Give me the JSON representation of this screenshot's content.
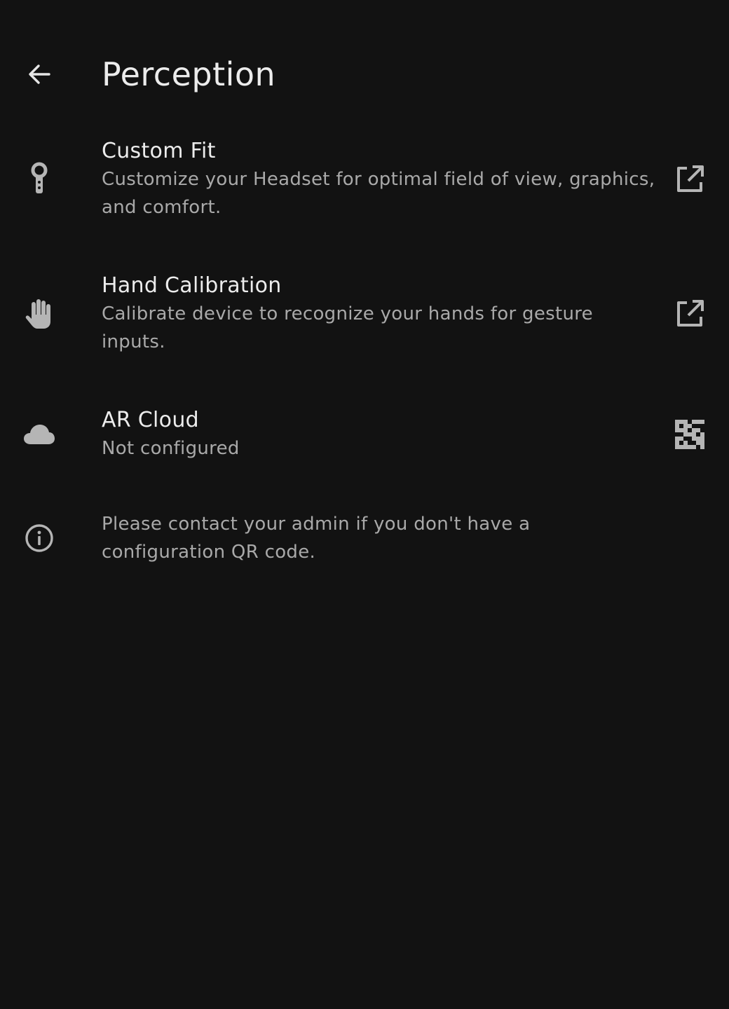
{
  "header": {
    "title": "Perception",
    "back_icon": "arrow-left-icon"
  },
  "colors": {
    "background": "#121212",
    "primary_text": "#ececec",
    "secondary_text": "#a9a9a9",
    "icon": "#b5b5b5"
  },
  "settings": {
    "custom_fit": {
      "title": "Custom Fit",
      "subtitle": "Customize your Headset for optimal field of view, graphics, and comfort.",
      "icon": "key-icon",
      "action_icon": "open-external-icon"
    },
    "hand_calibration": {
      "title": "Hand Calibration",
      "subtitle": "Calibrate device to recognize your hands for gesture inputs.",
      "icon": "hand-icon",
      "action_icon": "open-external-icon"
    },
    "ar_cloud": {
      "title": "AR Cloud",
      "subtitle": "Not configured",
      "icon": "cloud-icon",
      "action_icon": "qr-code-icon"
    }
  },
  "info": {
    "text": "Please contact your admin if you don't have a configuration QR code.",
    "icon": "info-icon"
  }
}
